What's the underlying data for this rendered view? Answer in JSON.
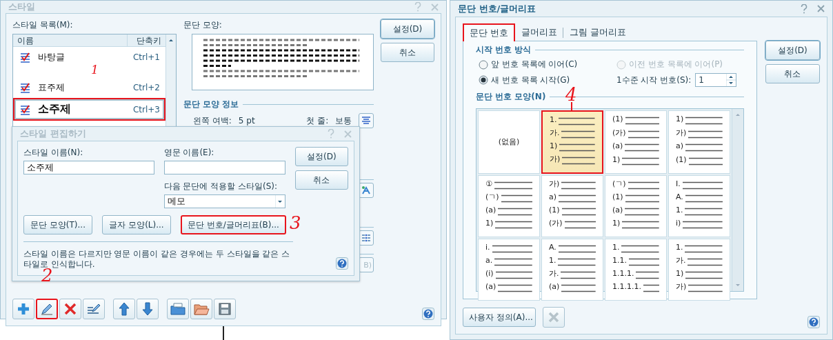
{
  "style_dialog": {
    "title": "스타일",
    "list_label": "스타일 목록(M):",
    "columns": [
      "이름",
      "단축키"
    ],
    "styles": [
      {
        "name": "바탕글",
        "shortcut": "Ctrl+1",
        "selected": false,
        "highlighted": false
      },
      {
        "name": "표주제",
        "shortcut": "Ctrl+2",
        "selected": false,
        "highlighted": false
      },
      {
        "name": "소주제",
        "shortcut": "Ctrl+3",
        "selected": true,
        "highlighted": true
      }
    ],
    "preview_label": "문단 모양:",
    "info_title": "문단 모양 정보",
    "info": [
      {
        "label": "왼쪽 여백:",
        "value": "5 pt"
      },
      {
        "label": "첫 줄:",
        "value": "보통"
      }
    ],
    "hidden_button_text": "B)",
    "buttons": [
      "설정(D)",
      "취소"
    ],
    "toolbar": [
      {
        "kind": "add",
        "highlighted": false
      },
      {
        "kind": "edit",
        "highlighted": true
      },
      {
        "kind": "delete",
        "highlighted": false
      },
      {
        "kind": "rename",
        "highlighted": false
      },
      {
        "kind": "up",
        "highlighted": false
      },
      {
        "kind": "down",
        "highlighted": false
      },
      {
        "kind": "import",
        "highlighted": false
      },
      {
        "kind": "open",
        "highlighted": false
      },
      {
        "kind": "save",
        "highlighted": false
      }
    ]
  },
  "edit_dialog": {
    "title": "스타일 편집하기",
    "name_label": "스타일 이름(N):",
    "name_value": "소주제",
    "english_label": "영문 이름(E):",
    "next_label": "다음 문단에 적용할 스타일(S):",
    "next_value": "메모",
    "buttons": [
      "설정(D)",
      "취소"
    ],
    "actions": [
      {
        "label": "문단 모양(T)...",
        "highlighted": false
      },
      {
        "label": "글자 모양(L)...",
        "highlighted": false
      },
      {
        "label": "문단 번호/글머리표(B)...",
        "highlighted": true
      }
    ],
    "note": "스타일 이름은 다르지만 영문 이름이 같은 경우에는 두 스타일을 같은 스타일로 인식합니다."
  },
  "numbering_dialog": {
    "title": "문단 번호/글머리표",
    "tabs": [
      {
        "label": "문단 번호",
        "selected": true,
        "highlighted": true
      },
      {
        "label": "글머리표",
        "selected": false,
        "highlighted": false
      },
      {
        "label": "그림 글머리표",
        "selected": false,
        "highlighted": false
      }
    ],
    "start_group": "시작 번호 방식",
    "options": [
      {
        "label": "앞 번호 목록에 이어(C)",
        "selected": false,
        "disabled": false
      },
      {
        "label": "이전 번호 목록에 이어(P)",
        "selected": false,
        "disabled": true
      },
      {
        "label": "새 번호 목록 시작(G)",
        "selected": true,
        "disabled": false
      }
    ],
    "level_label": "1수준 시작 번호(S):",
    "level_value": "1",
    "shape_group": "문단 번호 모양(N)",
    "cells": [
      {
        "kind": "none",
        "text": "(없음)",
        "selected": false,
        "highlighted": false
      },
      {
        "kind": "levels",
        "labels": [
          "1.",
          "가.",
          "1)",
          "가)"
        ],
        "selected": true,
        "highlighted": true
      },
      {
        "kind": "levels",
        "labels": [
          "(1)",
          "(가)",
          "(a)",
          "1)"
        ],
        "selected": false,
        "highlighted": false
      },
      {
        "kind": "levels",
        "labels": [
          "1)",
          "가)",
          "a)",
          "(1)"
        ],
        "selected": false,
        "highlighted": false
      },
      {
        "kind": "levels",
        "labels": [
          "①",
          "(ㄱ)",
          "(a)",
          "1)"
        ],
        "selected": false,
        "highlighted": false
      },
      {
        "kind": "levels",
        "labels": [
          "가)",
          "a)",
          "(1)",
          "(가)"
        ],
        "selected": false,
        "highlighted": false
      },
      {
        "kind": "levels",
        "labels": [
          "(ㄱ)",
          "(1)",
          "(a)",
          "1)"
        ],
        "selected": false,
        "highlighted": false
      },
      {
        "kind": "levels",
        "labels": [
          "I.",
          "A.",
          "1.",
          "i)"
        ],
        "selected": false,
        "highlighted": false
      },
      {
        "kind": "levels",
        "labels": [
          "i.",
          "a.",
          "(i)",
          "(a)"
        ],
        "selected": false,
        "highlighted": false
      },
      {
        "kind": "levels",
        "labels": [
          "A.",
          "1.",
          "가.",
          "(a)"
        ],
        "selected": false,
        "highlighted": false
      },
      {
        "kind": "levels",
        "labels": [
          "1.",
          "1.1.",
          "1.1.1.",
          "1.1.1.1."
        ],
        "selected": false,
        "highlighted": false
      },
      {
        "kind": "levels",
        "labels": [
          "1.",
          "가.",
          "1)",
          "가)"
        ],
        "selected": false,
        "highlighted": false
      }
    ],
    "buttons": [
      "설정(D)",
      "취소"
    ],
    "custom_button": "사용자 정의(A)..."
  },
  "annotations": [
    {
      "text": "1"
    },
    {
      "text": "2"
    },
    {
      "text": "3"
    },
    {
      "text": "4"
    }
  ]
}
